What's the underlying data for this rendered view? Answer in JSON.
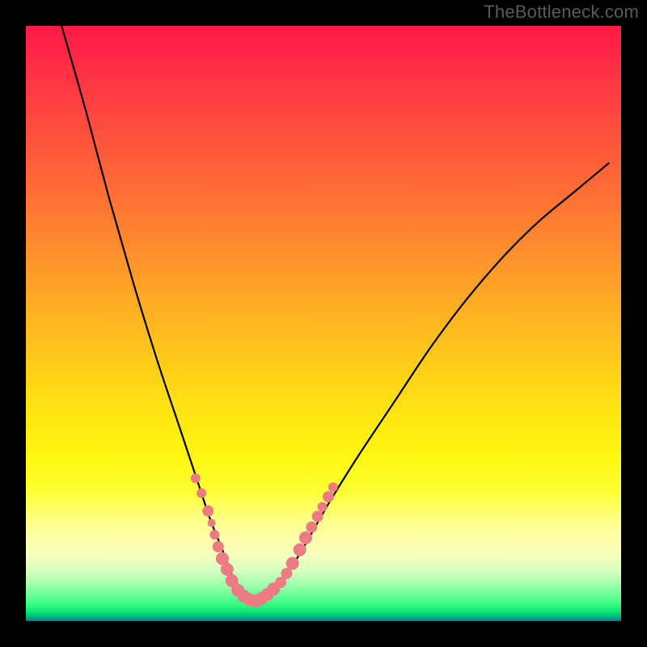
{
  "watermark": "TheBottleneck.com",
  "colors": {
    "frame": "#000000",
    "curve": "#000000",
    "beads": "#ed7b84",
    "gradient_top": "#ff1947",
    "gradient_bottom": "#007c99"
  },
  "chart_data": {
    "type": "line",
    "title": "",
    "xlabel": "",
    "ylabel": "",
    "xlim": [
      0,
      100
    ],
    "ylim": [
      0,
      100
    ],
    "grid": false,
    "legend": null,
    "note": "Axes are unlabeled in the source image; values are normalized 0–100 read from pixel position. y=0 at bottom (green), y=100 at top (red). Vertex ≈ x=37, y≈3.",
    "series": [
      {
        "name": "bottleneck-curve",
        "x": [
          6,
          10,
          14,
          18,
          22,
          26,
          29,
          31,
          33,
          34.5,
          36,
          37.5,
          39,
          40.5,
          42,
          44,
          47,
          51,
          56,
          62,
          68,
          74,
          80,
          86,
          92,
          98
        ],
        "y": [
          100,
          86,
          71,
          57,
          44,
          32,
          23,
          17,
          12,
          8,
          5.5,
          3.8,
          3.2,
          3.6,
          5,
          8,
          13,
          20,
          28,
          37,
          46,
          54,
          61,
          67,
          72,
          77
        ]
      }
    ],
    "beads_left": {
      "note": "pink dots on descending arm near bottom",
      "x": [
        28.5,
        29.5,
        30.6,
        31.2,
        31.7,
        32.3,
        33.0,
        33.8
      ],
      "y": [
        24,
        21.5,
        18.5,
        16.5,
        14.5,
        12.5,
        10.5,
        8.7
      ],
      "r": [
        6,
        6,
        7,
        5,
        6,
        7,
        8,
        8
      ]
    },
    "beads_right": {
      "note": "pink dots on ascending arm near bottom",
      "x": [
        42.8,
        43.8,
        44.8,
        46.0,
        47.0,
        48.0,
        49.0,
        49.8,
        50.8,
        51.6
      ],
      "y": [
        6.5,
        8.0,
        9.7,
        12.0,
        14.0,
        15.8,
        17.6,
        19.2,
        20.9,
        22.5
      ],
      "r": [
        7,
        7,
        8,
        8,
        8,
        7,
        7,
        6,
        7,
        6
      ]
    },
    "beads_bottom": {
      "note": "pink dots along the flat valley floor",
      "x": [
        34.6,
        35.6,
        36.6,
        37.6,
        38.6,
        39.6,
        40.6,
        41.6
      ],
      "y": [
        6.8,
        5.2,
        4.2,
        3.6,
        3.4,
        3.8,
        4.5,
        5.4
      ],
      "r": [
        8,
        8,
        8,
        8,
        8,
        8,
        8,
        8
      ]
    }
  }
}
